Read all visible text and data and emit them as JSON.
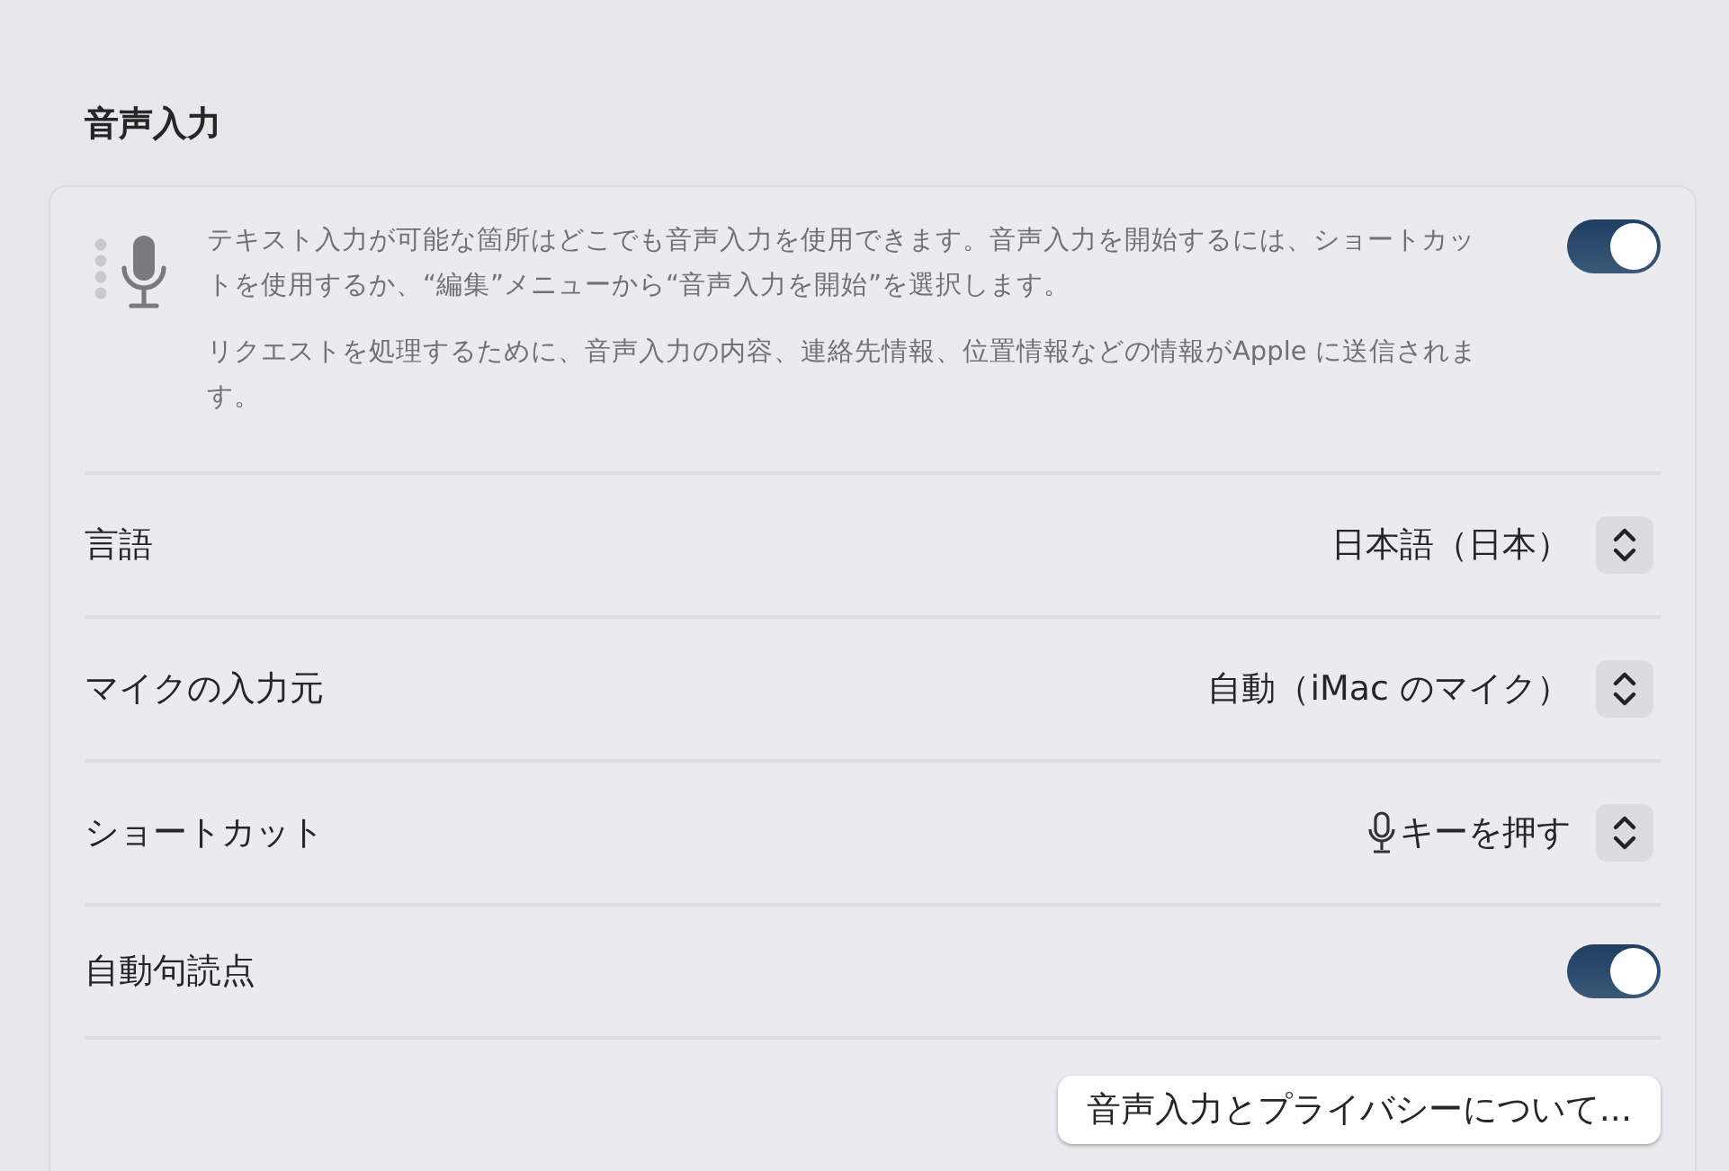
{
  "section_title": "音声入力",
  "intro": {
    "paragraphs": [
      "テキスト入力が可能な箇所はどこでも音声入力を使用できます。音声入力を開始するには、ショートカットを使用するか、“編集”メニューから“音声入力を開始”を選択します。",
      "リクエストを処理するために、音声入力の内容、連絡先情報、位置情報などの情報がApple に送信されます。"
    ],
    "on": true
  },
  "rows": [
    {
      "kind": "select",
      "label": "言語",
      "value": "日本語（日本）"
    },
    {
      "kind": "select",
      "label": "マイクの入力元",
      "value": "自動（iMac のマイク）"
    },
    {
      "kind": "mic_select",
      "label": "ショートカット",
      "value": "キーを押す"
    },
    {
      "kind": "toggle",
      "label": "自動句読点",
      "on": true
    }
  ],
  "button": "音声入力とプライバシーについて..."
}
